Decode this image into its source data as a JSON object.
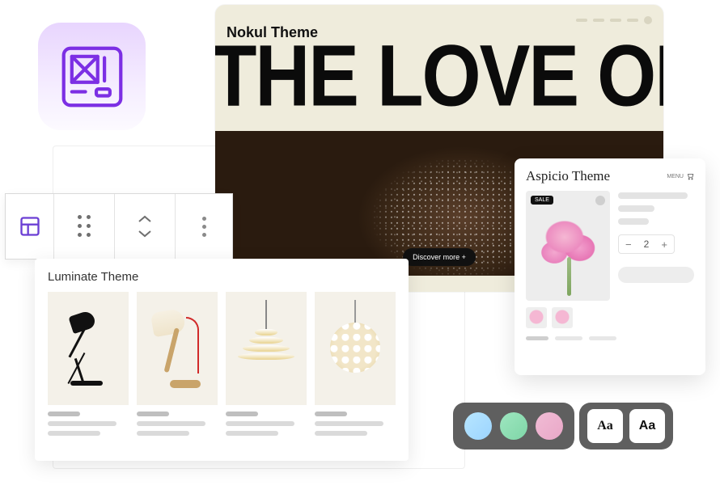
{
  "nokul": {
    "label": "Nokul Theme",
    "headline": "THE LOVE OF BREAD",
    "cta": "Discover more +"
  },
  "luminate": {
    "title": "Luminate Theme"
  },
  "aspicio": {
    "title": "Aspicio Theme",
    "corner_text": "MENU",
    "sale_badge": "SALE",
    "quantity": "2"
  },
  "typography": {
    "sample": "Aa"
  }
}
